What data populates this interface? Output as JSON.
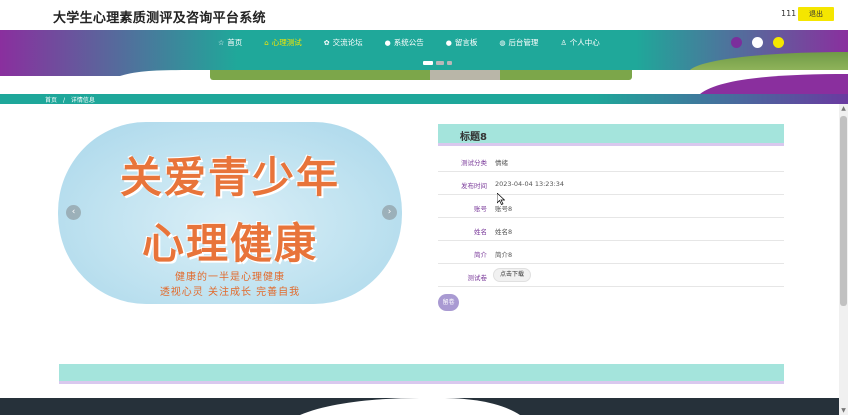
{
  "header": {
    "site_title": "大学生心理素质测评及咨询平台系统",
    "user_name": "111",
    "logout_label": "退出"
  },
  "nav": {
    "items": [
      {
        "icon": "home-icon",
        "glyph": "☆",
        "label": "首页"
      },
      {
        "icon": "psych-test-icon",
        "glyph": "⌂",
        "label": "心理测试"
      },
      {
        "icon": "forum-icon",
        "glyph": "✿",
        "label": "交流论坛"
      },
      {
        "icon": "notice-icon",
        "glyph": "●",
        "label": "系统公告"
      },
      {
        "icon": "message-board-icon",
        "glyph": "●",
        "label": "留言板"
      },
      {
        "icon": "admin-icon",
        "glyph": "◍",
        "label": "后台管理"
      },
      {
        "icon": "user-icon",
        "glyph": "♙",
        "label": "个人中心"
      }
    ],
    "active_index": 1,
    "theme_dots": [
      "#7b2f9c",
      "#ffffff",
      "#f5e600"
    ]
  },
  "breadcrumb": {
    "home": "首页",
    "separator": "/",
    "current": "详情信息"
  },
  "poster": {
    "line1": "关爱青少年",
    "line2": "心理健康",
    "sub1": "健康的一半是心理健康",
    "sub2": "透视心灵 关注成长 完善自我",
    "prev_glyph": "‹",
    "next_glyph": "›"
  },
  "detail": {
    "title": "标题8",
    "rows": [
      {
        "label": "测试分类",
        "value": "情绪"
      },
      {
        "label": "发布时间",
        "value": "2023-04-04 13:23:34"
      },
      {
        "label": "账号",
        "value": "账号8"
      },
      {
        "label": "姓名",
        "value": "姓名8"
      },
      {
        "label": "简介",
        "value": "简介8"
      },
      {
        "label": "测试卷",
        "value": "点击下载"
      }
    ],
    "reply_label": "留卷"
  },
  "colors": {
    "teal": "#1ea79a",
    "purple": "#7b2f9c",
    "yellow": "#f5e600",
    "light_teal": "#a4e4dc"
  }
}
